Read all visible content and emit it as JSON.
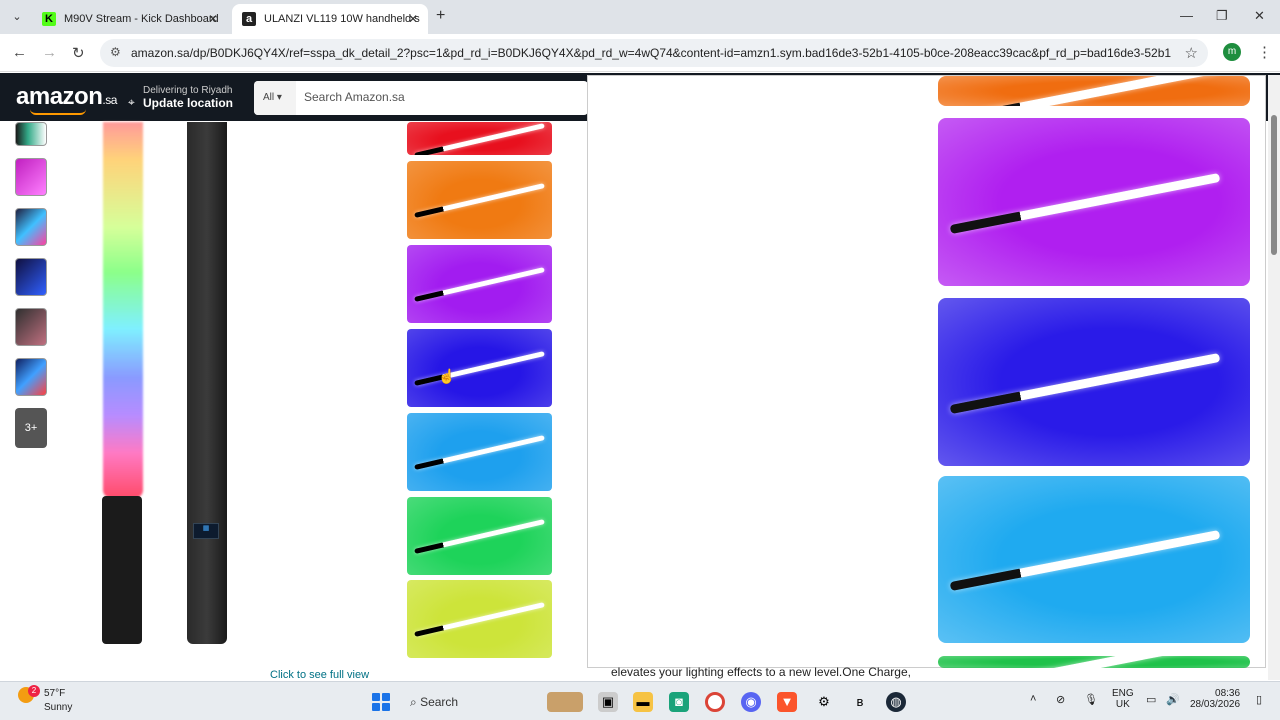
{
  "browser": {
    "tabs": [
      {
        "title": "M90V Stream - Kick Dashboard",
        "favicon": "K",
        "color": "#53fc18"
      },
      {
        "title": "ULANZI VL119 10W handheld s",
        "favicon": "a",
        "color": "#000000"
      }
    ],
    "url": "amazon.sa/dp/B0DKJ6QY4X/ref=sspa_dk_detail_2?psc=1&pd_rd_i=B0DKJ6QY4X&pd_rd_w=4wQ74&content-id=amzn1.sym.bad16de3-52b1-4105-b0ce-208eacc39cac&pf_rd_p=bad16de3-52b1-4105-...",
    "profile_initial": "m"
  },
  "amazon": {
    "logo": "amazon",
    "logo_suffix": ".sa",
    "deliver_line1": "Delivering to Riyadh",
    "deliver_line2": "Update location",
    "search_category": "All",
    "search_placeholder": "Search Amazon.sa",
    "thumb_more": "3+",
    "click_full_view": "Click to see full view",
    "description_snippet": "elevates your lighting effects to a new level.One Charge,",
    "color_tiles": [
      "#e8101e",
      "#f07a12",
      "#a21cf0",
      "#2616e6",
      "#1ea0ee",
      "#1ed35a",
      "#cde43a"
    ],
    "zoom_tiles": [
      "#f06d10",
      "#b01ff0",
      "#2a1be8",
      "#1faaf0",
      "#1fc24a"
    ]
  },
  "taskbar": {
    "weather_temp": "57°F",
    "weather_cond": "Sunny",
    "notif_count": "2",
    "search_label": "Search",
    "lang1": "ENG",
    "lang2": "UK",
    "time": "08:36",
    "date": "28/03/2026"
  }
}
